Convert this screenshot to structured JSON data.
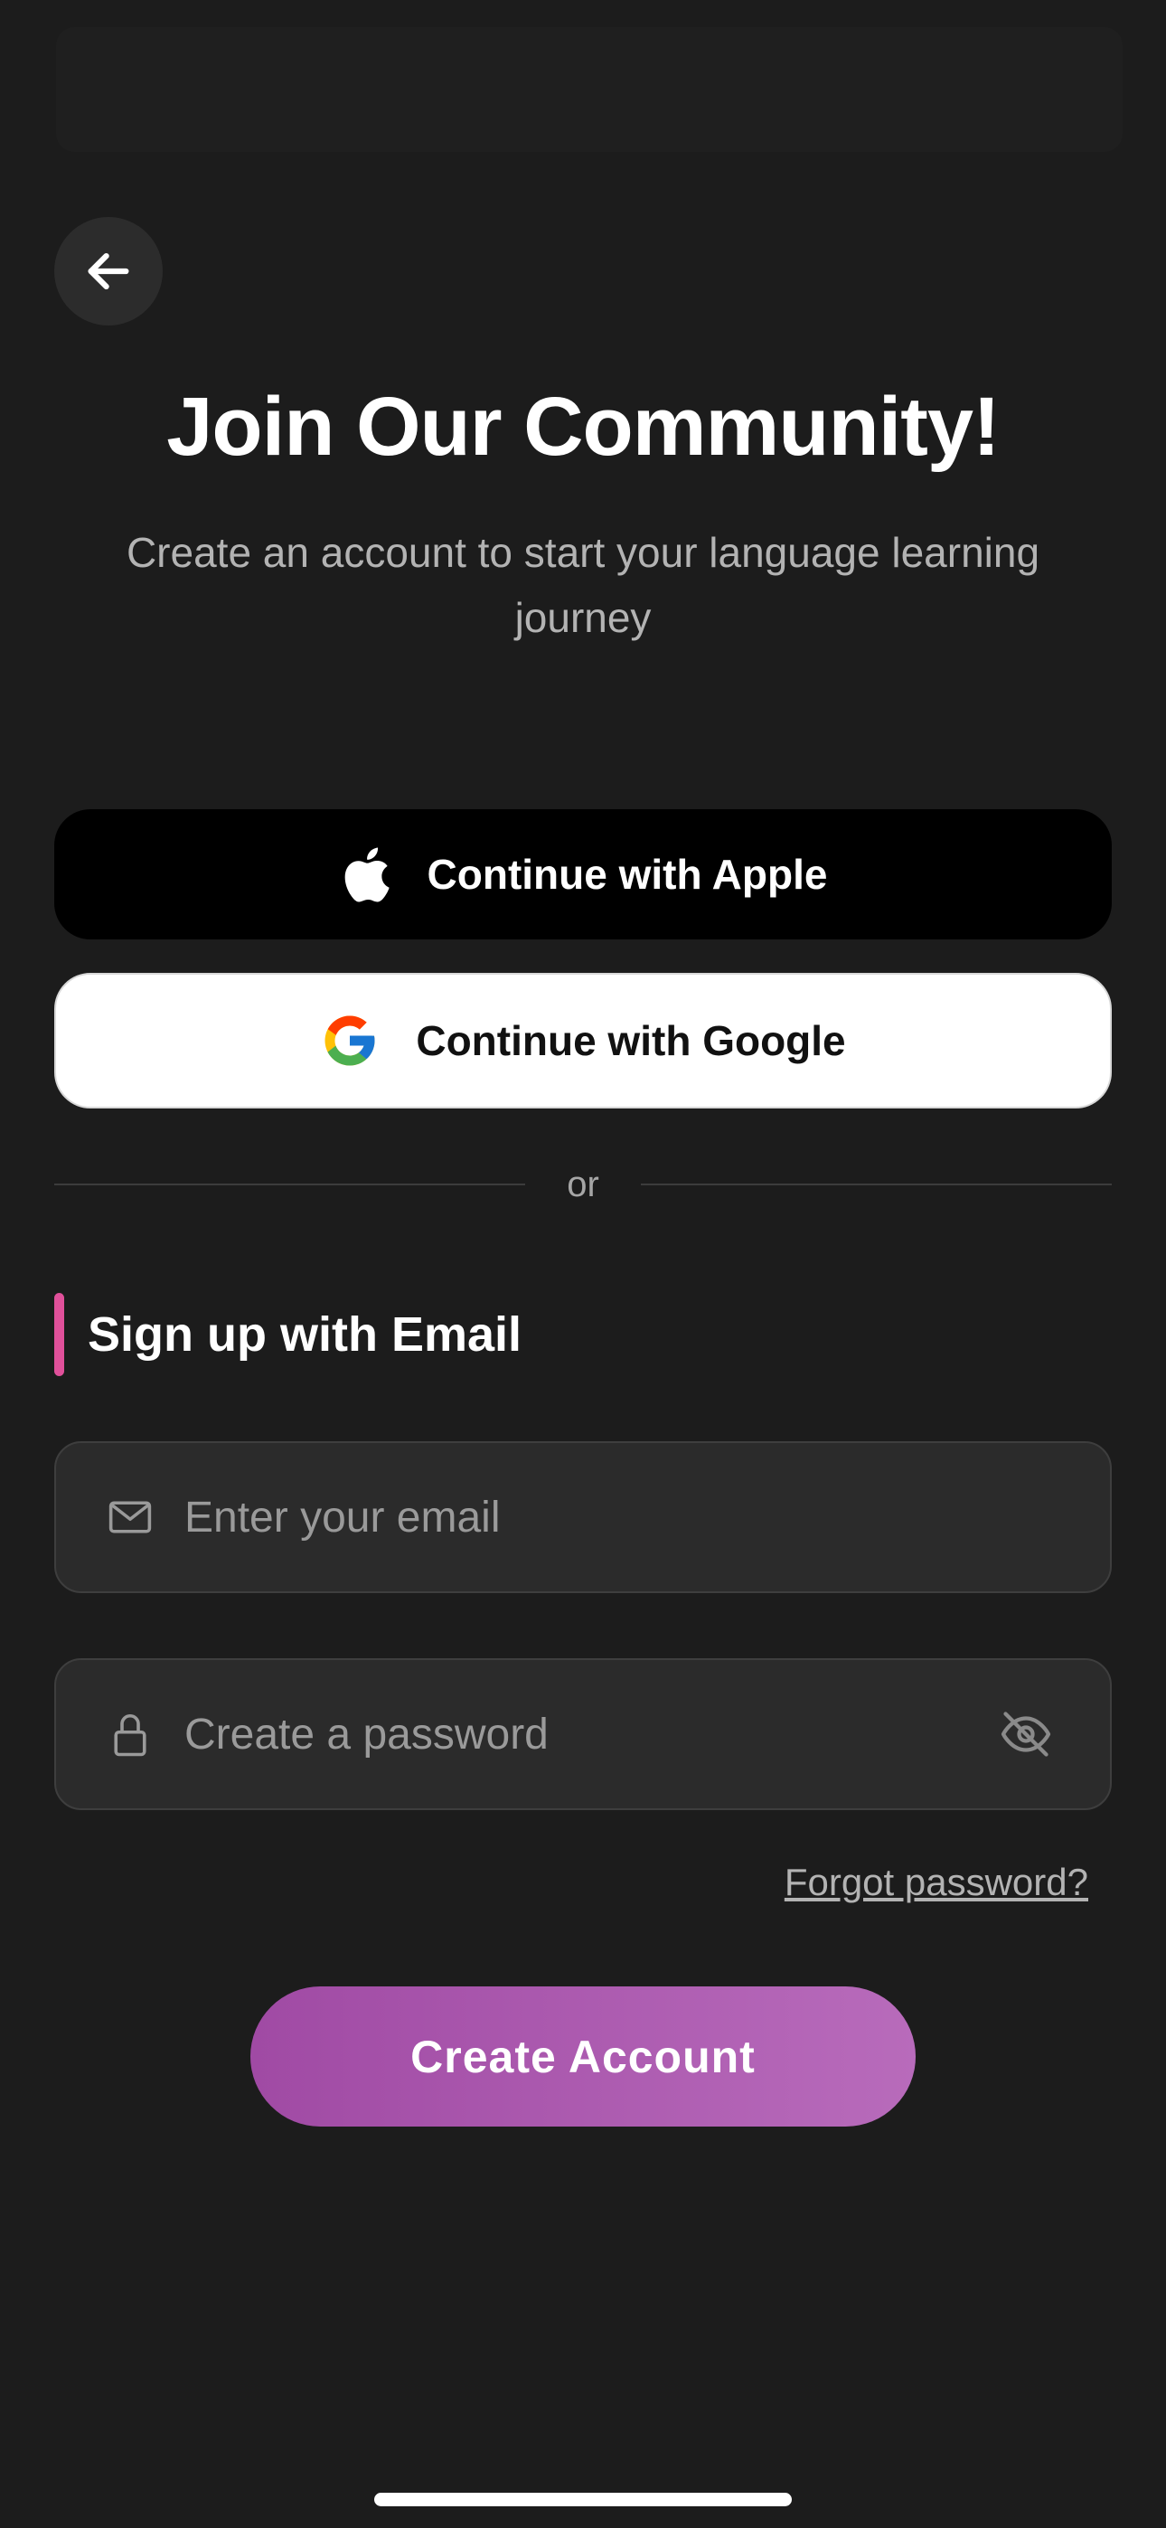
{
  "header": {
    "title": "Join Our Community!",
    "subtitle": "Create an account to start your language learning journey"
  },
  "social": {
    "apple_label": "Continue with Apple",
    "google_label": "Continue with Google"
  },
  "divider": {
    "text": "or"
  },
  "email_section": {
    "title": "Sign up with Email",
    "accent_color": "#e0509a",
    "email_placeholder": "Enter your email",
    "email_value": "",
    "password_placeholder": "Create a password",
    "password_value": ""
  },
  "links": {
    "forgot_password": "Forgot password?"
  },
  "actions": {
    "create_account": "Create Account",
    "create_gradient": [
      "#a04aa4",
      "#b86bbb"
    ]
  },
  "icons": {
    "back": "arrow-left-icon",
    "apple": "apple-logo-icon",
    "google": "google-logo-icon",
    "email": "envelope-icon",
    "password": "lock-icon",
    "visibility": "eye-slash-icon"
  }
}
